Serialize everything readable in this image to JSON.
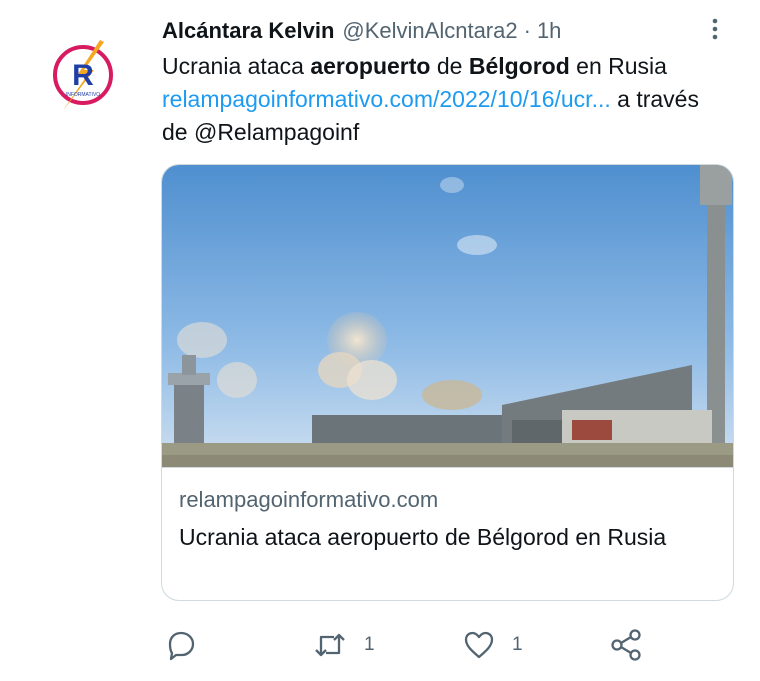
{
  "tweet": {
    "author_name": "Alcántara Kelvin",
    "author_handle": "@KelvinAlcntara2",
    "separator": "·",
    "time": "1h",
    "text_before_bold1": "Ucrania ataca ",
    "bold1": "aeropuerto",
    "text_between": " de ",
    "bold2": "Bélgorod",
    "text_after_bold2": " en Rusia ",
    "link_text": "relampagoinformativo.com/2022/10/16/ucr...",
    "via_text": " a través de @Relampagoinf",
    "avatar_letter": "R",
    "avatar_caption": "INFORMATIVO"
  },
  "card": {
    "domain": "relampagoinformativo.com",
    "title": "Ucrania ataca aeropuerto de Bélgorod en Rusia"
  },
  "actions": {
    "reply_count": "",
    "retweet_count": "1",
    "like_count": "1"
  },
  "colors": {
    "link": "#1d9bf0",
    "secondary_text": "#536471",
    "border": "#cfd9de"
  }
}
